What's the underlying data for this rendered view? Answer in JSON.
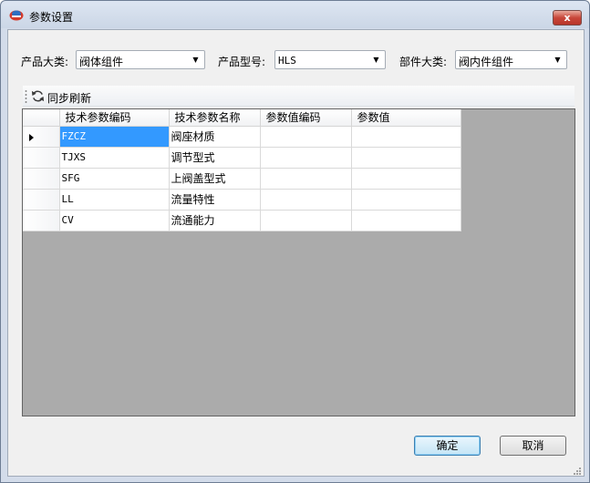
{
  "window": {
    "title": "参数设置",
    "close_glyph": "x",
    "app_icon": "app-logo-icon"
  },
  "filters": {
    "category_label": "产品大类:",
    "category_value": "阀体组件",
    "model_label": "产品型号:",
    "model_value": "HLS",
    "part_label": "部件大类:",
    "part_value": "阀内件组件"
  },
  "toolbar": {
    "refresh_label": "同步刷新",
    "refresh_icon": "refresh-icon"
  },
  "grid": {
    "columns": [
      "技术参数编码",
      "技术参数名称",
      "参数值编码",
      "参数值"
    ],
    "rows": [
      {
        "code": "FZCZ",
        "name": "阀座材质",
        "value_code": "",
        "value": ""
      },
      {
        "code": "TJXS",
        "name": "调节型式",
        "value_code": "",
        "value": ""
      },
      {
        "code": "SFG",
        "name": "上阀盖型式",
        "value_code": "",
        "value": ""
      },
      {
        "code": "LL",
        "name": "流量特性",
        "value_code": "",
        "value": ""
      },
      {
        "code": "CV",
        "name": "流通能力",
        "value_code": "",
        "value": ""
      }
    ],
    "selected_row": 0
  },
  "buttons": {
    "ok_label": "确定",
    "cancel_label": "取消"
  },
  "colors": {
    "selection": "#3399ff",
    "grid_background": "#ababab",
    "close_button": "#c8473a"
  }
}
